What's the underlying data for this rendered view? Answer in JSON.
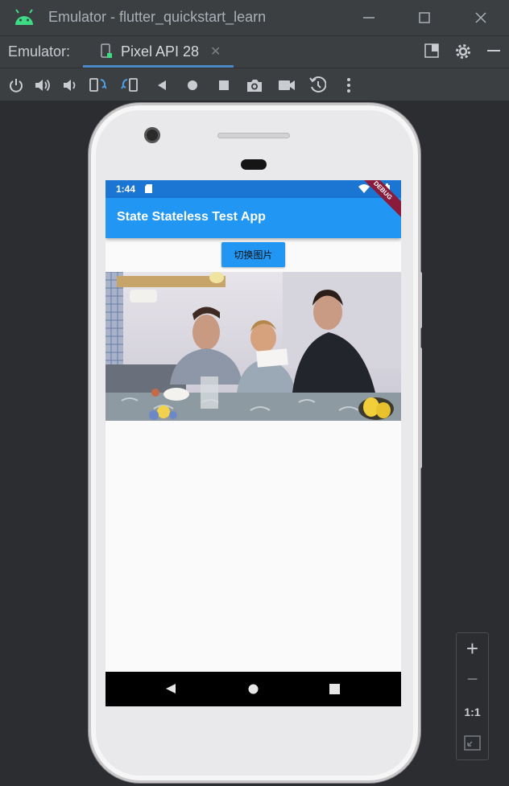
{
  "window": {
    "title": "Emulator - flutter_quickstart_learn"
  },
  "tabbar": {
    "label": "Emulator:",
    "tab_label": "Pixel API 28"
  },
  "toolbar": {
    "tools": [
      "power-icon",
      "volume-up-icon",
      "volume-down-icon",
      "rotate-left-icon",
      "rotate-right-icon",
      "back-icon",
      "home-icon",
      "overview-icon",
      "screenshot-icon",
      "screen-record-icon",
      "snapshot-icon",
      "more-icon"
    ]
  },
  "app": {
    "status_time": "1:44",
    "title": "State Stateless Test App",
    "debug_banner": "DEBUG",
    "switch_button_label": "切换图片",
    "appbar_color": "#2196f3",
    "statusbar_color": "#1a76d2"
  },
  "zoom": {
    "one_to_one": "1:1"
  }
}
